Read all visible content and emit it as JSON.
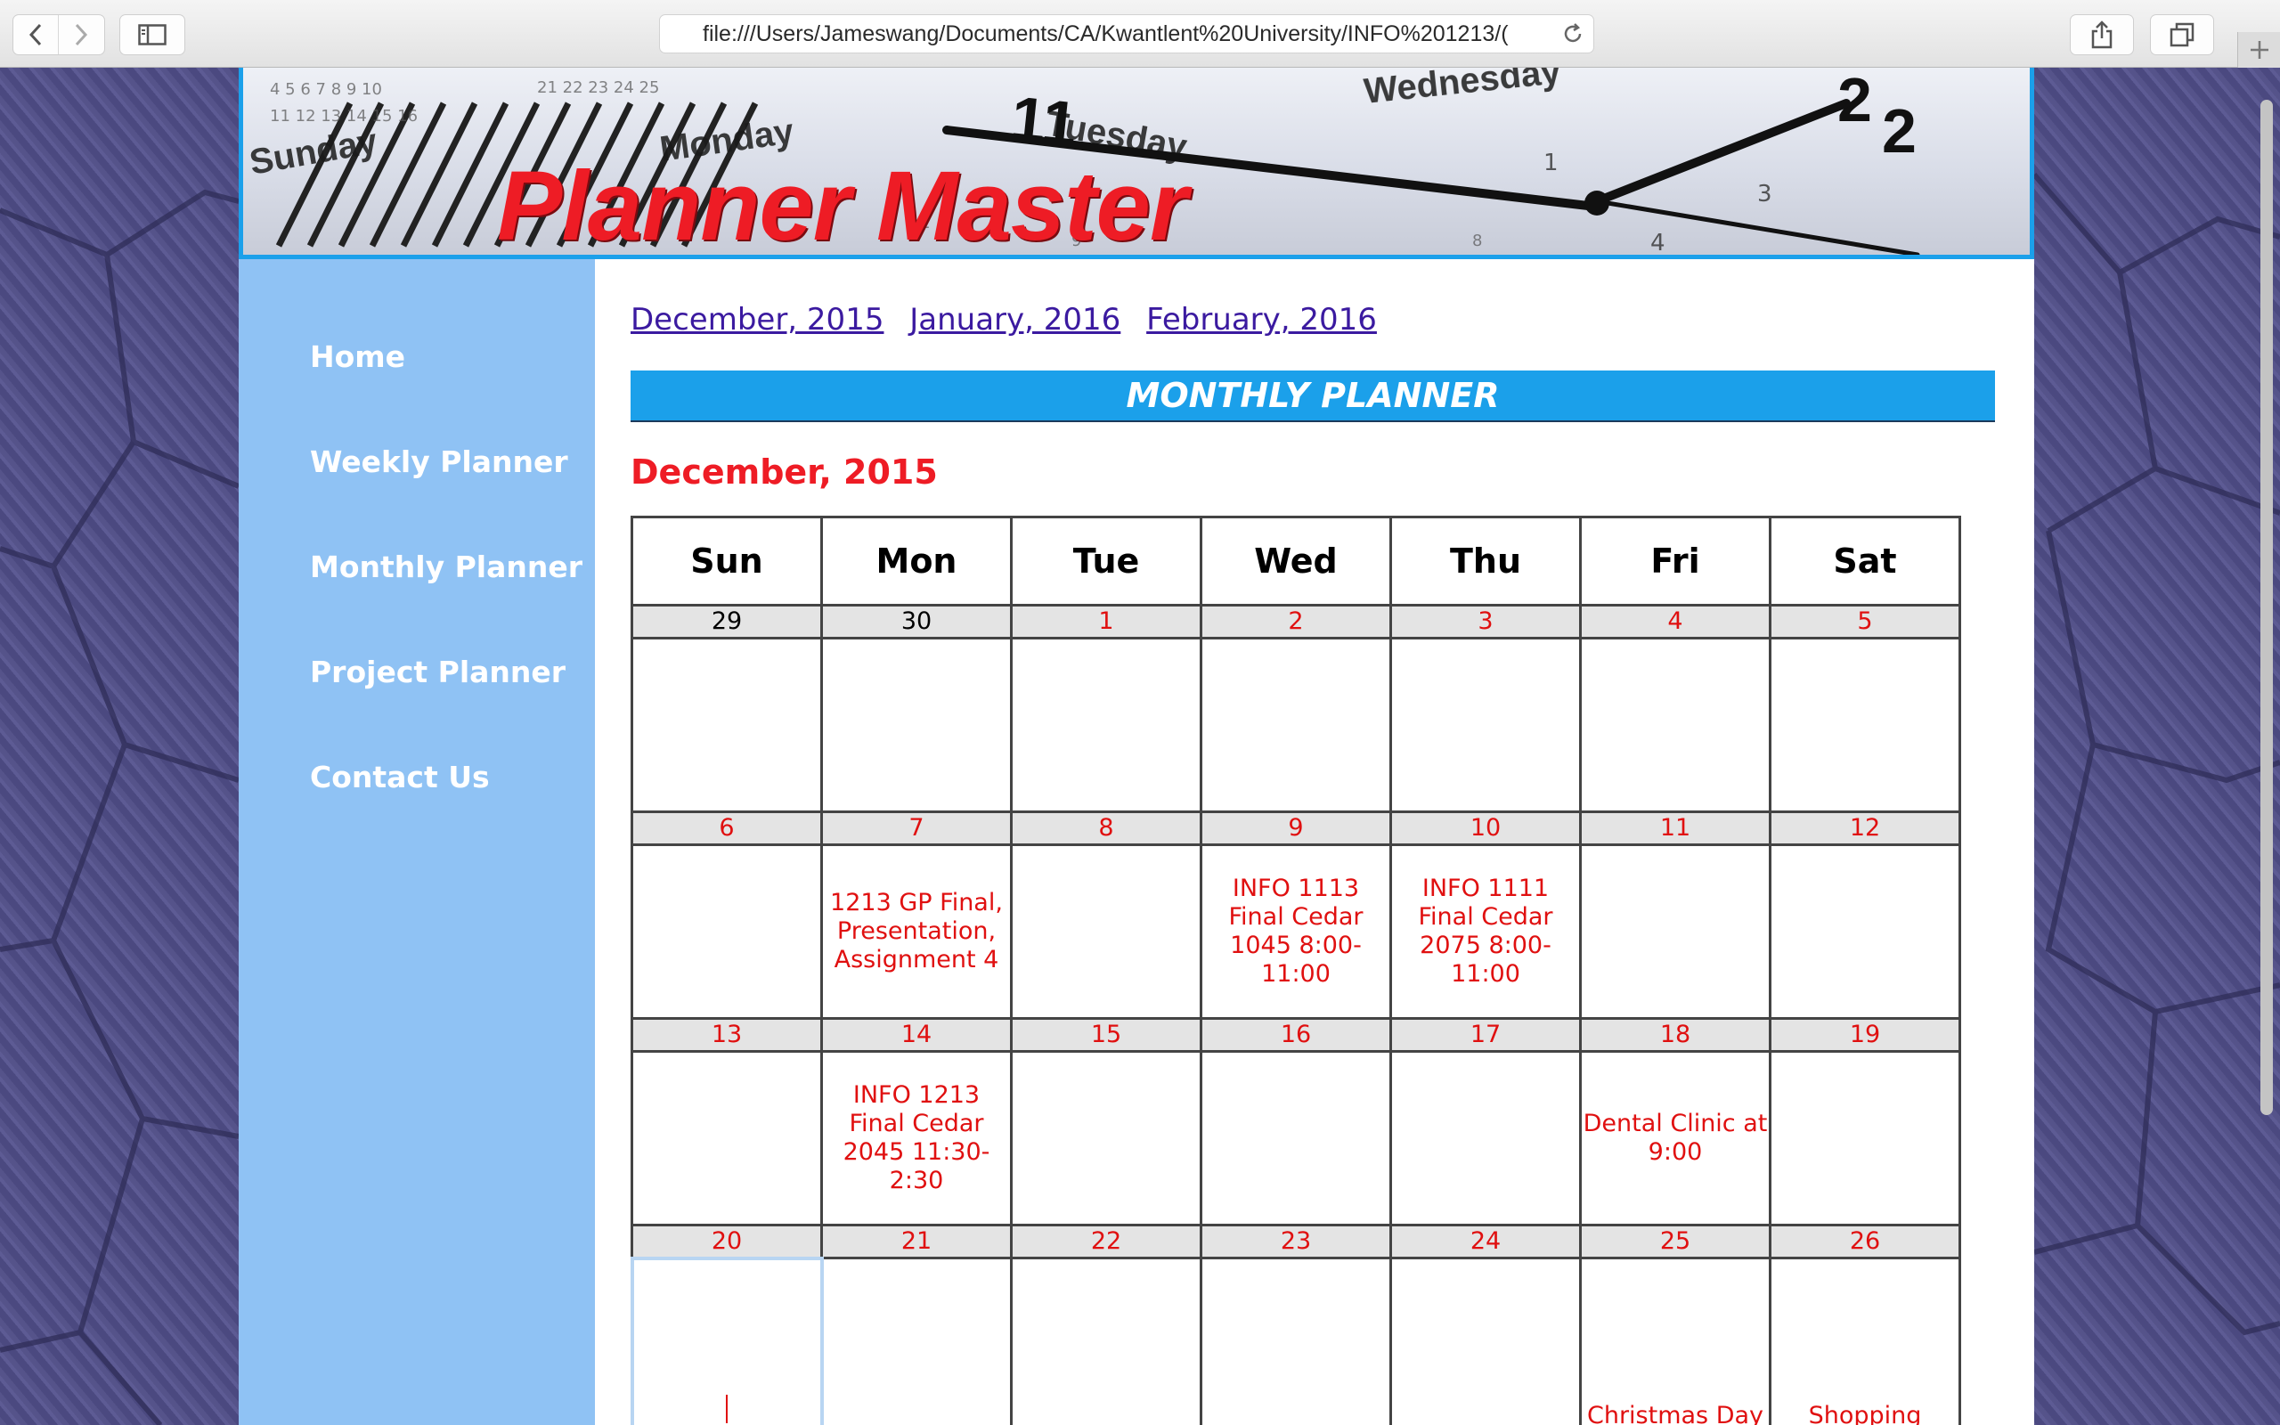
{
  "browser": {
    "url": "file:///Users/Jameswang/Documents/CA/Kwantlent%20University/INFO%201213/("
  },
  "banner": {
    "title": "Planner Master",
    "calendar_words": [
      "Sunday",
      "Monday",
      "Tuesday",
      "Wednesday"
    ]
  },
  "sidebar": {
    "items": [
      {
        "label": "Home"
      },
      {
        "label": "Weekly Planner"
      },
      {
        "label": "Monthly Planner"
      },
      {
        "label": "Project Planner"
      },
      {
        "label": "Contact Us"
      }
    ]
  },
  "month_links": [
    "December, 2015",
    "January, 2016",
    "February, 2016"
  ],
  "planner_heading": "MONTHLY PLANNER",
  "month_title": "December, 2015",
  "calendar": {
    "weekdays": [
      "Sun",
      "Mon",
      "Tue",
      "Wed",
      "Thu",
      "Fri",
      "Sat"
    ],
    "weeks": [
      {
        "days": [
          "29",
          "30",
          "1",
          "2",
          "3",
          "4",
          "5"
        ],
        "events": [
          "",
          "",
          "",
          "",
          "",
          "",
          ""
        ]
      },
      {
        "days": [
          "6",
          "7",
          "8",
          "9",
          "10",
          "11",
          "12"
        ],
        "events": [
          "",
          "1213 GP Final, Presentation, Assignment 4",
          "",
          "INFO 1113 Final Cedar 1045 8:00-11:00",
          "INFO 1111 Final Cedar 2075 8:00-11:00",
          "",
          ""
        ]
      },
      {
        "days": [
          "13",
          "14",
          "15",
          "16",
          "17",
          "18",
          "19"
        ],
        "events": [
          "",
          "INFO 1213 Final Cedar 2045 11:30-2:30",
          "",
          "",
          "",
          "Dental Clinic at 9:00",
          ""
        ]
      },
      {
        "days": [
          "20",
          "21",
          "22",
          "23",
          "24",
          "25",
          "26"
        ],
        "events": [
          "",
          "",
          "",
          "",
          "",
          "Christmas Day",
          "Shopping"
        ]
      }
    ]
  },
  "colors": {
    "accent_blue": "#1ba0ea",
    "sidebar_blue": "#8fc2f4",
    "title_red": "#ee1c25",
    "link_purple": "#3b1aa0"
  },
  "icons": [
    "back-icon",
    "forward-icon",
    "sidebar-icon",
    "reload-icon",
    "share-icon",
    "tabs-icon",
    "plus-icon"
  ]
}
